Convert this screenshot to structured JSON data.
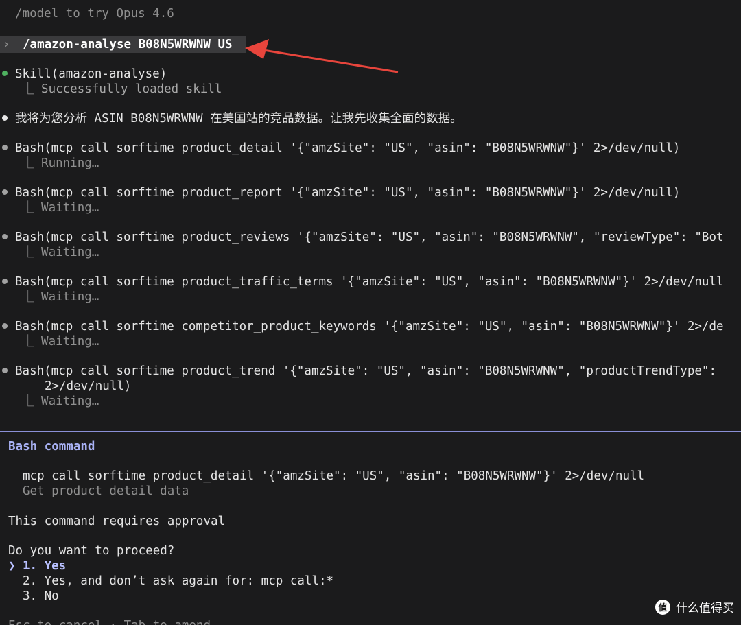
{
  "history": {
    "tip": "/model to try Opus 4.6",
    "prompt_glyph": "›",
    "user_command": "/amazon-analyse B08N5WRWNW US"
  },
  "skill": {
    "title": "Skill(amazon-analyse)",
    "result": "⎿ Successfully loaded skill"
  },
  "assistant_message": "我将为您分析 ASIN B08N5WRWNW 在美国站的竞品数据。让我先收集全面的数据。",
  "bash_calls": [
    {
      "command": "Bash(mcp call sorftime product_detail '{\"amzSite\": \"US\", \"asin\": \"B08N5WRWNW\"}' 2>/dev/null)",
      "status": "⎿ Running…"
    },
    {
      "command": "Bash(mcp call sorftime product_report '{\"amzSite\": \"US\", \"asin\": \"B08N5WRWNW\"}' 2>/dev/null)",
      "status": "⎿ Waiting…"
    },
    {
      "command": "Bash(mcp call sorftime product_reviews '{\"amzSite\": \"US\", \"asin\": \"B08N5WRWNW\", \"reviewType\": \"Bot",
      "status": "⎿ Waiting…"
    },
    {
      "command": "Bash(mcp call sorftime product_traffic_terms '{\"amzSite\": \"US\", \"asin\": \"B08N5WRWNW\"}' 2>/dev/null",
      "status": "⎿ Waiting…"
    },
    {
      "command": "Bash(mcp call sorftime competitor_product_keywords '{\"amzSite\": \"US\", \"asin\": \"B08N5WRWNW\"}' 2>/de",
      "status": "⎿ Waiting…"
    },
    {
      "command": "Bash(mcp call sorftime product_trend '{\"amzSite\": \"US\", \"asin\": \"B08N5WRWNW\", \"productTrendType\":",
      "continuation": "2>/dev/null)",
      "status": "⎿ Waiting…"
    }
  ],
  "dialog": {
    "title": "Bash command",
    "command": "mcp call sorftime product_detail '{\"amzSite\": \"US\", \"asin\": \"B08N5WRWNW\"}' 2>/dev/null",
    "description": "Get product detail data",
    "approval_note": "This command requires approval",
    "question": "Do you want to proceed?",
    "cursor": "❯",
    "options": [
      "1. Yes",
      "2. Yes, and don’t ask again for: mcp call:*",
      "3. No"
    ],
    "footer": "Esc to cancel · Tab to amend"
  },
  "watermark": {
    "icon_text": "值",
    "text": "什么值得买"
  },
  "colors": {
    "background": "#1b1b1c",
    "success_bullet": "#4fb160",
    "divider": "#8a8fd6",
    "annotation_arrow": "#e8453c"
  }
}
